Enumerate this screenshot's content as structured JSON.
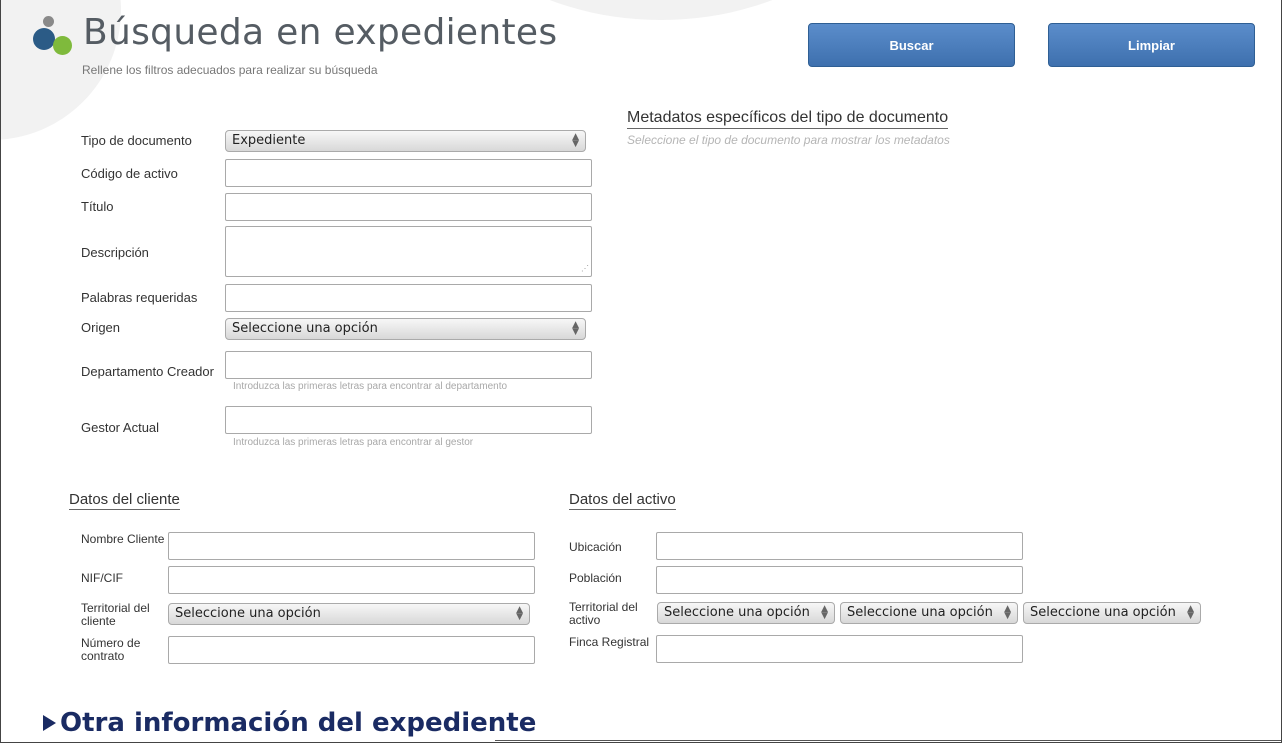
{
  "header": {
    "title": "Búsqueda en expedientes",
    "subtitle": "Rellene los filtros adecuados para realizar su búsqueda",
    "buscar_label": "Buscar",
    "limpiar_label": "Limpiar"
  },
  "main_form": {
    "tipo_documento": {
      "label": "Tipo de documento",
      "value": "Expediente"
    },
    "codigo_activo": {
      "label": "Código de activo",
      "value": ""
    },
    "titulo": {
      "label": "Título",
      "value": ""
    },
    "descripcion": {
      "label": "Descripción",
      "value": ""
    },
    "palabras_requeridas": {
      "label": "Palabras requeridas",
      "value": ""
    },
    "origen": {
      "label": "Origen",
      "value": "Seleccione una opción"
    },
    "departamento_creador": {
      "label": "Departamento Creador",
      "value": "",
      "hint": "Introduzca las primeras letras para encontrar al departamento"
    },
    "gestor_actual": {
      "label": "Gestor Actual",
      "value": "",
      "hint": "Introduzca las primeras letras para encontrar al gestor"
    }
  },
  "metadatos": {
    "title": "Metadatos específicos del tipo de documento",
    "subtitle": "Seleccione el tipo de documento para mostrar los metadatos"
  },
  "datos_cliente": {
    "title": "Datos del cliente",
    "nombre_cliente": {
      "label": "Nombre Cliente",
      "value": ""
    },
    "nif_cif": {
      "label": "NIF/CIF",
      "value": ""
    },
    "territorial_cliente": {
      "label": "Territorial del cliente",
      "value": "Seleccione una opción"
    },
    "numero_contrato": {
      "label": "Número de contrato",
      "value": ""
    }
  },
  "datos_activo": {
    "title": "Datos del activo",
    "ubicacion": {
      "label": "Ubicación",
      "value": ""
    },
    "poblacion": {
      "label": "Población",
      "value": ""
    },
    "territorial_activo": {
      "label": "Territorial del activo",
      "values": [
        "Seleccione una opción",
        "Seleccione una opción",
        "Seleccione una opción"
      ]
    },
    "finca_registral": {
      "label": "Finca Registral",
      "value": ""
    }
  },
  "otra_info": {
    "label": "Otra información del expediente"
  },
  "icons": {
    "logo": "logo-dots-icon",
    "collapse": "triangle-right-icon",
    "select_arrow": "updown-arrow-icon"
  },
  "colors": {
    "button": "#4a7cbc",
    "heading": "#1a2b63",
    "logo_blue": "#2b5b86",
    "logo_green": "#7fba3c"
  }
}
